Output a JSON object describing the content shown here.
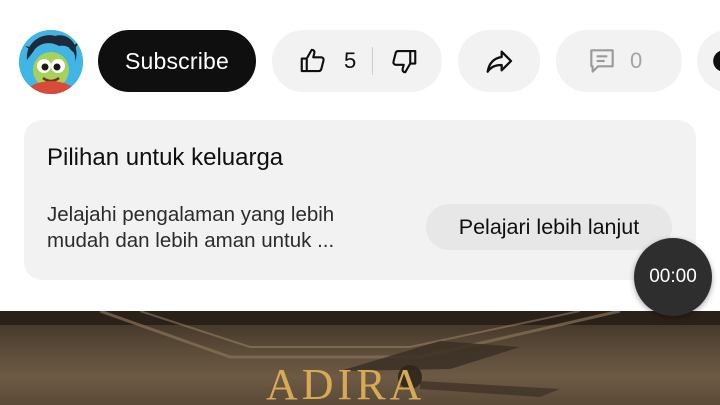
{
  "header": {
    "subscribe_label": "Subscribe"
  },
  "actions": {
    "like_count": "5",
    "comment_count": "0"
  },
  "family_card": {
    "title": "Pilihan untuk keluarga",
    "description_line1": "Jelajahi pengalaman yang lebih",
    "description_line2": "mudah dan lebih aman untuk ...",
    "learn_more_label": "Pelajari lebih lanjut"
  },
  "overlay": {
    "timer": "00:00"
  },
  "video_thumbnail": {
    "brand_text": "ADIRA"
  },
  "icons": {
    "like": "thumbs-up-icon",
    "dislike": "thumbs-down-icon",
    "share": "share-icon",
    "comment": "comment-icon",
    "avatar": "channel-avatar"
  },
  "colors": {
    "subscribe_bg": "#0f0f0f",
    "pill_bg": "#f2f2f2",
    "card_bg": "#f2f2f2",
    "learn_more_bg": "#e7e7e7",
    "timer_bg": "#2e2e2e",
    "brand_gold": "#d7ab55"
  }
}
